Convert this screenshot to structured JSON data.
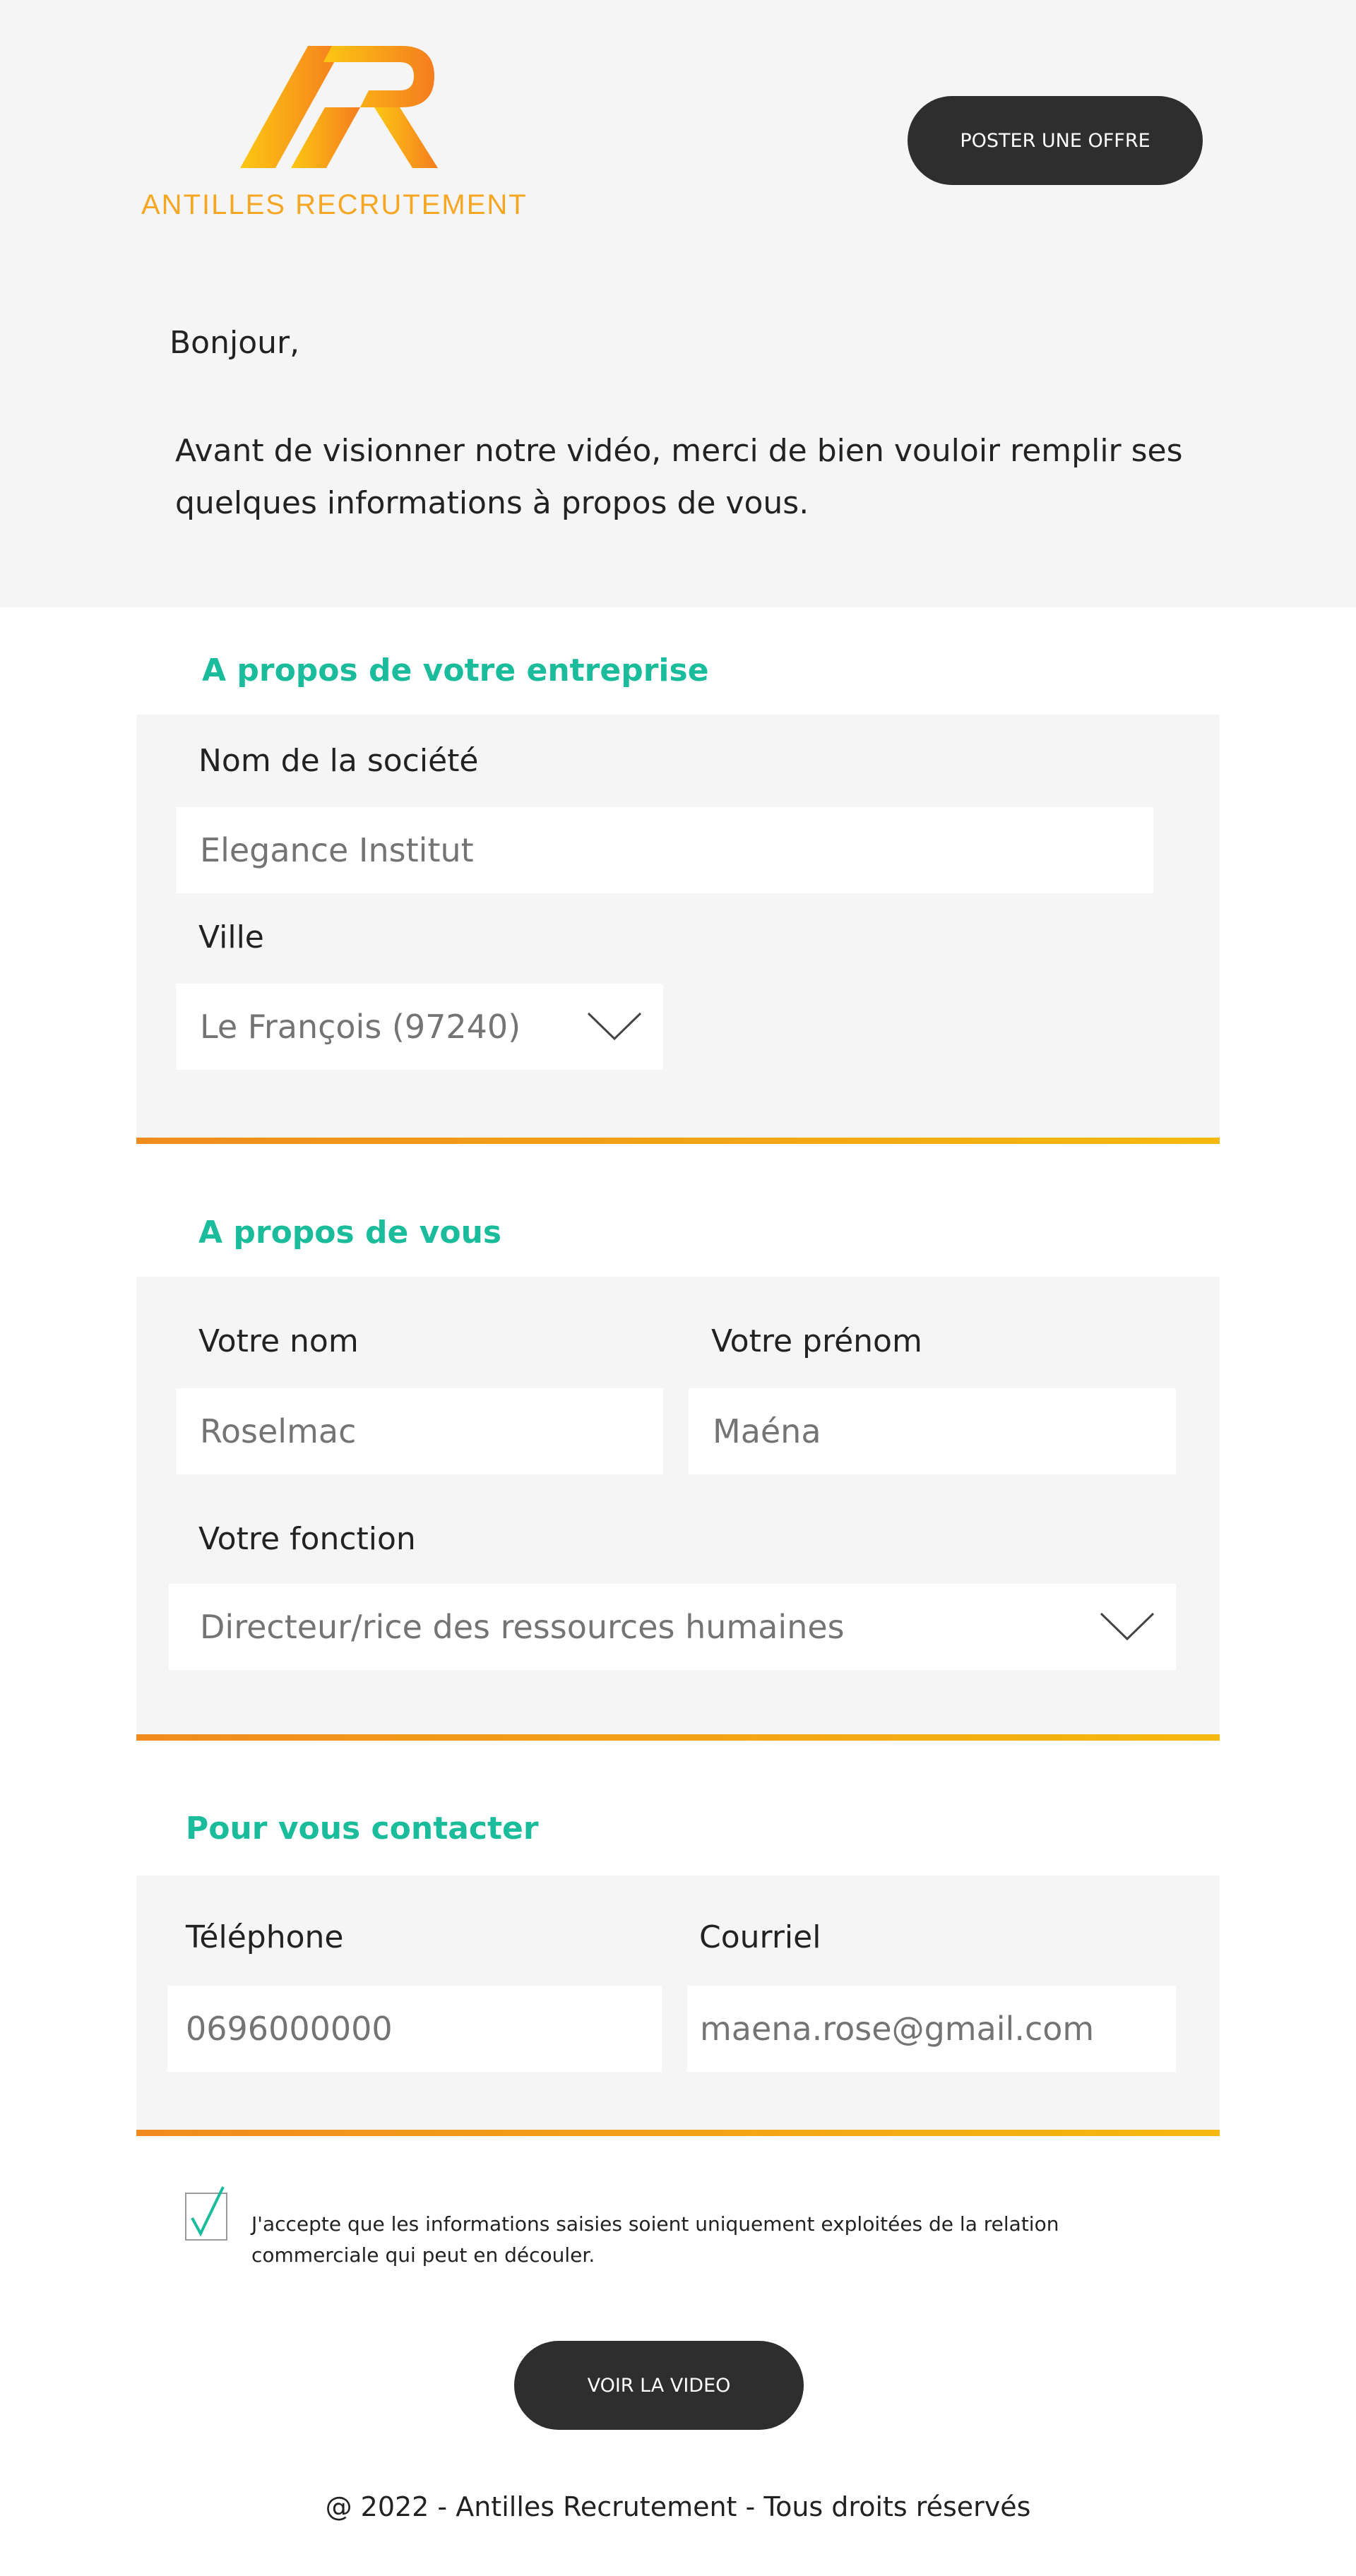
{
  "brand": {
    "name": "ANTILLES RECRUTEMENT",
    "gradient_start": "#fcc713",
    "gradient_end": "#f57c1f",
    "accent": "#1bbc9b",
    "bar_gradient": [
      "#f08c1e",
      "#f5b90f"
    ]
  },
  "header": {
    "post_offer_label": "POSTER UNE OFFRE",
    "greeting": "Bonjour,",
    "intro": "Avant de visionner notre vidéo, merci de bien vouloir remplir ses quelques informations à propos de vous."
  },
  "company": {
    "title": "A propos de votre entreprise",
    "name_label": "Nom de la société",
    "name_value": "Elegance Institut",
    "city_label": "Ville",
    "city_value": "Le François (97240)",
    "city_icon": "chevron-down-icon"
  },
  "about": {
    "title": "A propos de vous",
    "lastname_label": "Votre nom",
    "lastname_value": "Roselmac",
    "firstname_label": "Votre prénom",
    "firstname_value": "Maéna",
    "role_label": "Votre fonction",
    "role_value": "Directeur/rice des ressources humaines",
    "role_icon": "chevron-down-icon"
  },
  "contact": {
    "title": "Pour vous contacter",
    "phone_label": "Téléphone",
    "phone_value": "0696000000",
    "email_label": "Courriel",
    "email_value": "maena.rose@gmail.com"
  },
  "consent": {
    "checked": true,
    "text": "J'accepte que les informations saisies soient uniquement exploitées de la relation commerciale qui peut en découler."
  },
  "actions": {
    "watch_video_label": "VOIR LA VIDEO"
  },
  "footer": {
    "text": "@ 2022 - Antilles Recrutement - Tous droits réservés"
  }
}
